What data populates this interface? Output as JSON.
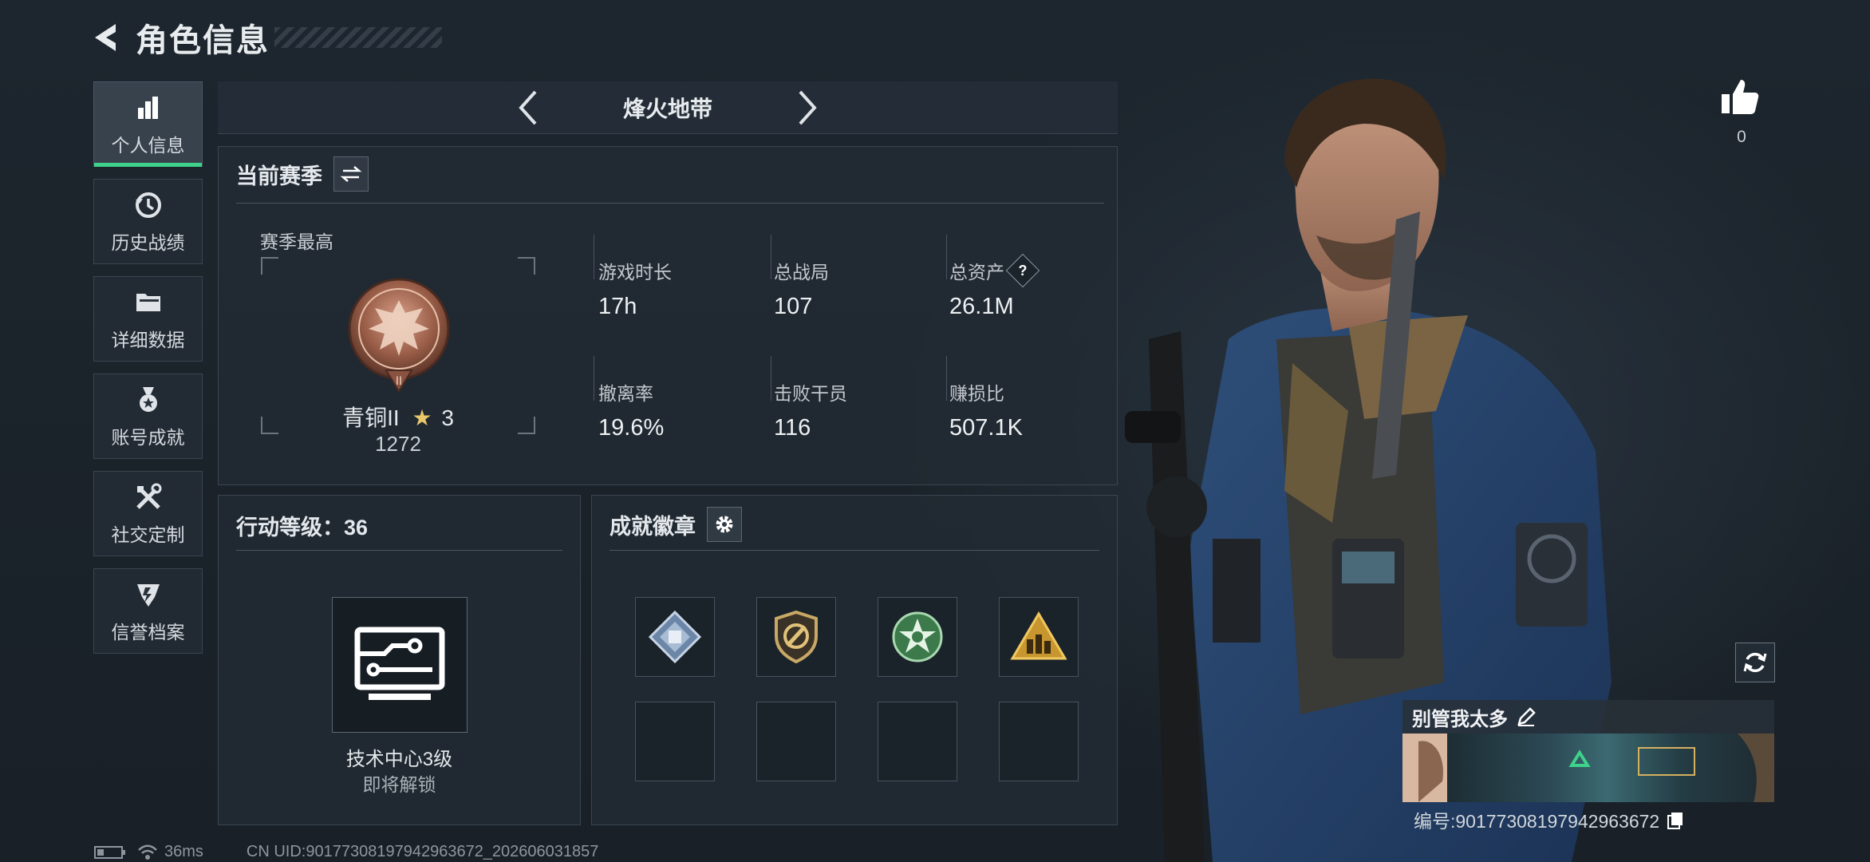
{
  "header": {
    "title": "角色信息"
  },
  "nav": {
    "items": [
      {
        "label": "个人信息",
        "icon": "bar-chart-icon",
        "active": true
      },
      {
        "label": "历史战绩",
        "icon": "history-clock-icon",
        "active": false
      },
      {
        "label": "详细数据",
        "icon": "folder-icon",
        "active": false
      },
      {
        "label": "账号成就",
        "icon": "medal-icon",
        "active": false
      },
      {
        "label": "社交定制",
        "icon": "tools-icon",
        "active": false
      },
      {
        "label": "信誉档案",
        "icon": "shield-wing-icon",
        "active": false
      }
    ]
  },
  "mode": {
    "title": "烽火地带"
  },
  "season": {
    "title": "当前赛季",
    "best_label": "赛季最高",
    "rank_name": "青铜II",
    "rank_stars": "3",
    "rank_score": "1272",
    "stats": [
      {
        "label": "游戏时长",
        "value": "17h"
      },
      {
        "label": "总战局",
        "value": "107"
      },
      {
        "label": "总资产",
        "value": "26.1M",
        "help": "?"
      },
      {
        "label": "撤离率",
        "value": "19.6%"
      },
      {
        "label": "击败干员",
        "value": "116"
      },
      {
        "label": "赚损比",
        "value": "507.1K"
      }
    ]
  },
  "level": {
    "title": "行动等级：36",
    "unlock_title": "技术中心3级",
    "unlock_sub": "即将解锁"
  },
  "badges": {
    "title": "成就徽章",
    "items": [
      {
        "icon": "badge-crystal-icon"
      },
      {
        "icon": "badge-shield-icon"
      },
      {
        "icon": "badge-star-icon"
      },
      {
        "icon": "badge-triangle-icon"
      }
    ]
  },
  "profile": {
    "like_count": "0",
    "player_name": "别管我太多",
    "id_text": "编号:9017730819794296367​2"
  },
  "status": {
    "ping": "36ms",
    "uid": "CN UID:9017730819794296367​2_202606031857"
  },
  "colors": {
    "accent": "#3fd28a",
    "panel": "#222b33",
    "background": "#1b232b"
  }
}
